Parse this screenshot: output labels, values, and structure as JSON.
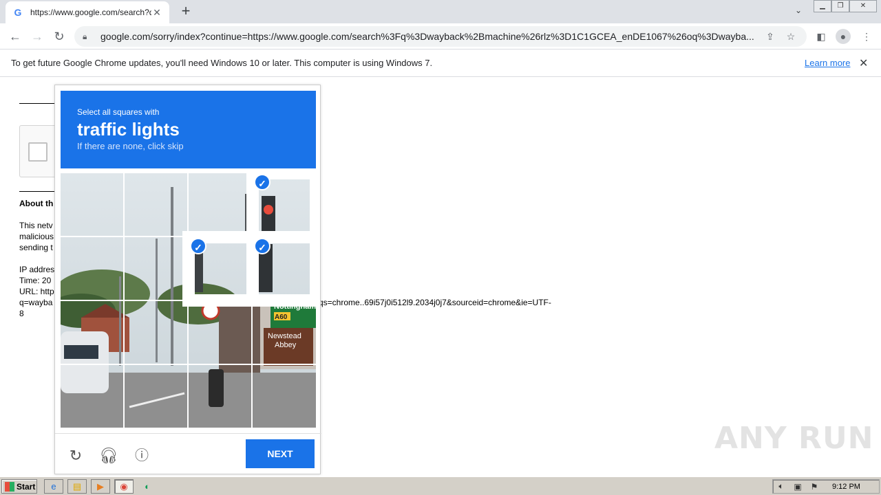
{
  "browser": {
    "tab_title": "https://www.google.com/search?q=",
    "tab_icon": "G",
    "new_tab": "+",
    "url": "google.com/sorry/index?continue=https://www.google.com/search%3Fq%3Dwayback%2Bmachine%26rlz%3D1C1GCEA_enDE1067%26oq%3Dwayba..."
  },
  "infobar": {
    "message": "To get future Google Chrome updates, you'll need Windows 10 or later. This computer is using Windows 7.",
    "learn_more": "Learn more"
  },
  "page": {
    "about": "About th",
    "line1": "This netv",
    "line2": "malicious",
    "line3": "sending t",
    "ip": "IP addres",
    "time": "Time: 20",
    "url_label": "URL: http",
    "url_line2": "q=wayba",
    "url_tail": "qs=chrome..69i57j0i512l9.2034j0j7&sourceid=chrome&ie=UTF-",
    "url_end": "8"
  },
  "challenge": {
    "instruction_small": "Select all squares with",
    "instruction_big": "traffic lights",
    "hint": "If there are none, click skip",
    "next_label": "NEXT",
    "tiles": [
      {
        "row": 0,
        "col": 0,
        "selected": false
      },
      {
        "row": 0,
        "col": 1,
        "selected": false
      },
      {
        "row": 0,
        "col": 2,
        "selected": false
      },
      {
        "row": 0,
        "col": 3,
        "selected": true
      },
      {
        "row": 1,
        "col": 0,
        "selected": false
      },
      {
        "row": 1,
        "col": 1,
        "selected": false
      },
      {
        "row": 1,
        "col": 2,
        "selected": true
      },
      {
        "row": 1,
        "col": 3,
        "selected": true
      },
      {
        "row": 2,
        "col": 0,
        "selected": false
      },
      {
        "row": 2,
        "col": 1,
        "selected": false
      },
      {
        "row": 2,
        "col": 2,
        "selected": false
      },
      {
        "row": 2,
        "col": 3,
        "selected": false
      },
      {
        "row": 3,
        "col": 0,
        "selected": false
      },
      {
        "row": 3,
        "col": 1,
        "selected": false
      },
      {
        "row": 3,
        "col": 2,
        "selected": false
      },
      {
        "row": 3,
        "col": 3,
        "selected": false
      }
    ],
    "sign1": "Nottingham",
    "sign2": "A60",
    "sign3": "Newstead",
    "sign4": "Abbey"
  },
  "watermark": "ANY RUN",
  "taskbar": {
    "start": "Start",
    "clock": "9:12 PM"
  },
  "colors": {
    "accent": "#1a73e8"
  }
}
